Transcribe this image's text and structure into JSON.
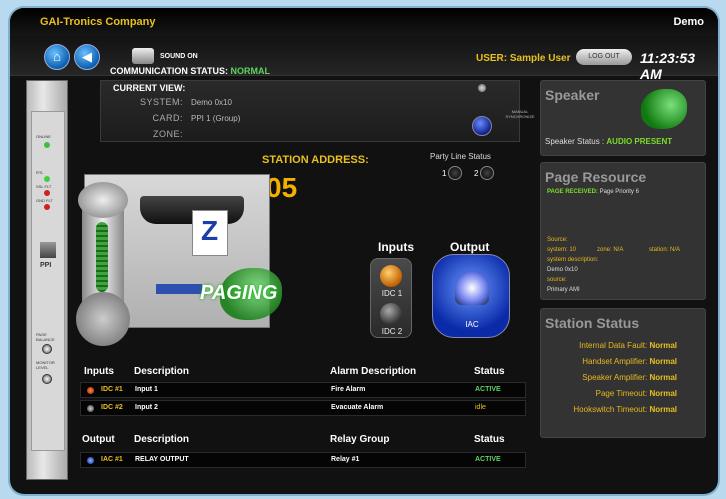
{
  "header": {
    "company": "GAI-Tronics Company",
    "mode": "Demo"
  },
  "nav": {
    "sound": "SOUND ON",
    "user": "USER: Sample User",
    "logout": "LOG OUT",
    "clock": "11:23:53 AM"
  },
  "rack": {
    "label_online": "ONLINE",
    "label_rtl": "RTL",
    "label_ssl": "SSL FLT",
    "label_gnd": "GND FLT",
    "label_ppi": "PPI",
    "label_page": "PAGE BALANCE",
    "label_monitor": "MONITOR LEVEL"
  },
  "comm": {
    "label": "COMMUNICATION STATUS:",
    "value": "NORMAL"
  },
  "current_view": {
    "title": "CURRENT VIEW:",
    "system_label": "SYSTEM:",
    "system_value": "Demo 0x10",
    "card_label": "CARD:",
    "card_value": "PPI 1 (Group)",
    "zone_label": "ZONE:",
    "manual_sync": "MANUAL SYNCHRONIZE"
  },
  "station": {
    "label": "STATION ADDRESS:",
    "value": "05"
  },
  "party_line": {
    "label": "Party Line Status",
    "btn1": "1",
    "btn2": "2"
  },
  "device": {
    "paging": "PAGING",
    "inputs_head": "Inputs",
    "output_head": "Output",
    "idc1": "IDC 1",
    "idc2": "IDC 2",
    "iac": "IAC"
  },
  "inputs_table": {
    "headers": [
      "Inputs",
      "Description",
      "Alarm Description",
      "Status"
    ],
    "rows": [
      {
        "id": "IDC #1",
        "desc": "Input 1",
        "alarm": "Fire Alarm",
        "status": "ACTIVE"
      },
      {
        "id": "IDC #2",
        "desc": "Input 2",
        "alarm": "Evacuate Alarm",
        "status": "idle"
      }
    ]
  },
  "output_table": {
    "headers": [
      "Output",
      "Description",
      "Relay Group",
      "Status"
    ],
    "rows": [
      {
        "id": "IAC #1",
        "desc": "RELAY OUTPUT",
        "relay": "Relay #1",
        "status": "ACTIVE"
      }
    ]
  },
  "speaker_panel": {
    "title": "Speaker",
    "status_label": "Speaker Status :",
    "status_value": "AUDIO PRESENT"
  },
  "page_resource": {
    "title": "Page Resource",
    "received_label": "PAGE RECEIVED:",
    "received_value": "Page Priority  6",
    "source_label": "Source:",
    "system": "system: 10",
    "zone": "zone: N/A",
    "station": "station: N/A",
    "sys_desc": "system description:",
    "sys_desc_value": "Demo 0x10",
    "source2": "source:",
    "source2_value": "Primary AMI"
  },
  "station_status": {
    "title": "Station Status",
    "rows": [
      {
        "label": "Internal Data Fault:",
        "value": "Normal"
      },
      {
        "label": "Handset Amplifier:",
        "value": "Normal"
      },
      {
        "label": "Speaker Amplifier:",
        "value": "Normal"
      },
      {
        "label": "Page Timeout:",
        "value": "Normal"
      },
      {
        "label": "Hookswitch Timeout:",
        "value": "Normal"
      }
    ]
  },
  "colors": {
    "accent_yellow": "#e8c020",
    "ok_green": "#5fd35f",
    "active_green": "#7cdc2c"
  }
}
